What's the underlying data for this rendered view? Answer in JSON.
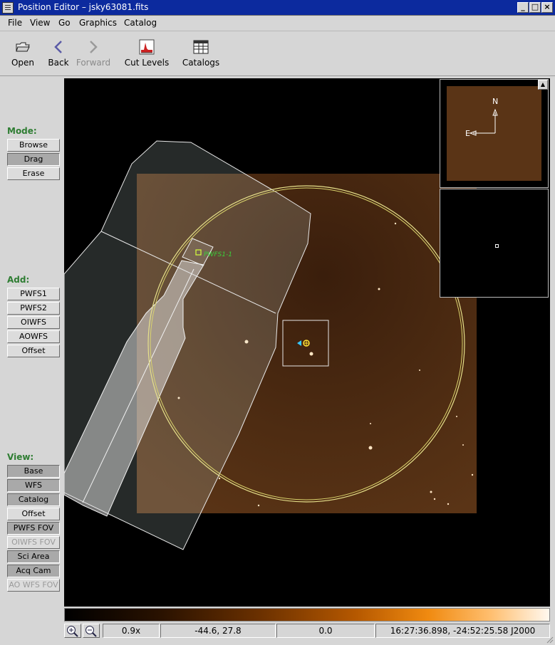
{
  "window": {
    "title": "Position Editor – jsky63081.fits",
    "controls": [
      "_",
      "□",
      "×"
    ]
  },
  "menu": [
    "File",
    "View",
    "Go",
    "Graphics",
    "Catalog"
  ],
  "toolbar": {
    "open": "Open",
    "back": "Back",
    "forward": "Forward",
    "cut_levels": "Cut Levels",
    "catalogs": "Catalogs"
  },
  "sidebar": {
    "mode_label": "Mode:",
    "mode": [
      {
        "label": "Browse",
        "active": false
      },
      {
        "label": "Drag",
        "active": true
      },
      {
        "label": "Erase",
        "active": false
      }
    ],
    "add_label": "Add:",
    "add": [
      "PWFS1",
      "PWFS2",
      "OIWFS",
      "AOWFS",
      "Offset"
    ],
    "view_label": "View:",
    "view": [
      {
        "label": "Base",
        "active": true,
        "disabled": false
      },
      {
        "label": "WFS",
        "active": true,
        "disabled": false
      },
      {
        "label": "Catalog",
        "active": true,
        "disabled": false
      },
      {
        "label": "Offset",
        "active": false,
        "disabled": false
      },
      {
        "label": "PWFS FOV",
        "active": true,
        "disabled": false
      },
      {
        "label": "OIWFS FOV",
        "active": false,
        "disabled": true
      },
      {
        "label": "Sci Area",
        "active": true,
        "disabled": false
      },
      {
        "label": "Acq Cam",
        "active": true,
        "disabled": false
      },
      {
        "label": "AO WFS FOV",
        "active": false,
        "disabled": true
      }
    ]
  },
  "image": {
    "probe_label": "PWFS1-1",
    "compass": {
      "north": "N",
      "east": "E"
    }
  },
  "status": {
    "zoom": "0.9x",
    "pixel_xy": "-44.6, 27.8",
    "pixel_value": "0.0",
    "wcs": "16:27:36.898, -24:52:25.58 J2000"
  },
  "colors": {
    "titlebar": "#0c2a9e",
    "mode_label": "#2e7d32",
    "image_base": "#4a2a12",
    "sci_circle": "#e6e08a",
    "probe_label": "#3ad13a",
    "offset_marker": "#37c8ff"
  },
  "icons": [
    "folder-open-icon",
    "back-arrow-icon",
    "forward-arrow-icon",
    "cut-levels-icon",
    "catalogs-table-icon",
    "zoom-in-icon",
    "zoom-out-icon"
  ]
}
